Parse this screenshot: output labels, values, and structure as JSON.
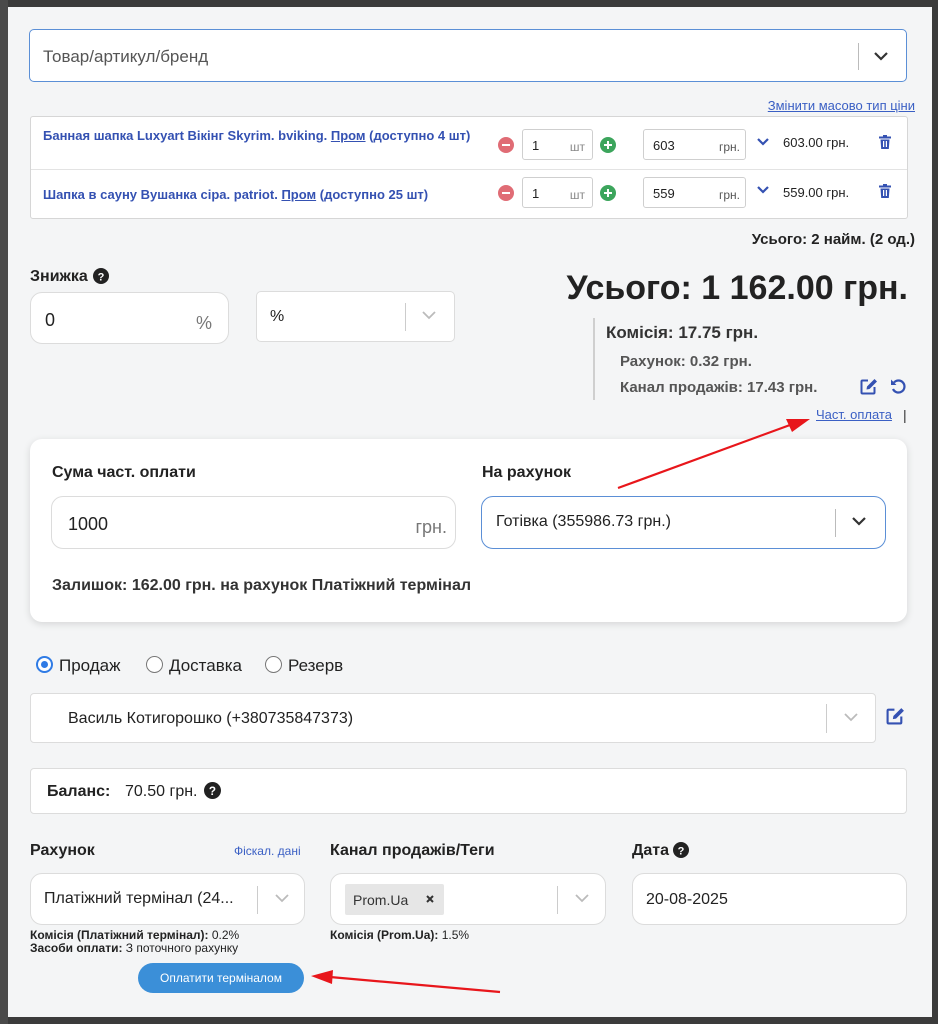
{
  "search": {
    "placeholder": "Товар/артикул/бренд"
  },
  "bulk_price_link": "Змінити масово тип ціни",
  "items": [
    {
      "name": "Банная шапка Luxyart Вікінг Skyrim. bviking.",
      "source": "Пром",
      "stock": "(доступно 4 шт)",
      "qty": "1",
      "qty_unit": "шт",
      "price": "603",
      "price_unit": "грн.",
      "total": "603.00 грн."
    },
    {
      "name": "Шапка в сауну Вушанка сіра. patriot.",
      "source": "Пром",
      "stock": "(доступно 25 шт)",
      "qty": "1",
      "qty_unit": "шт",
      "price": "559",
      "price_unit": "грн.",
      "total": "559.00 грн."
    }
  ],
  "items_summary": "Усього: 2 найм. (2 од.)",
  "discount": {
    "label": "Знижка",
    "value": "0",
    "unit": "%",
    "type": "%"
  },
  "totals": {
    "grand": "Усього: 1 162.00 грн.",
    "commission": "Комісія: 17.75 грн.",
    "commission_account": "Рахунок: 0.32 грн.",
    "commission_channel": "Канал продажів: 17.43 грн.",
    "partial_link": "Част. оплата",
    "separator": "|"
  },
  "partial": {
    "sum_label": "Сума част. оплати",
    "sum_value": "1000",
    "sum_unit": "грн.",
    "account_label": "На рахунок",
    "account_value": "Готівка (355986.73 грн.)",
    "remainder": "Залишок: 162.00 грн. на рахунок Платіжний термінал"
  },
  "order_types": [
    {
      "label": "Продаж",
      "selected": true
    },
    {
      "label": "Доставка",
      "selected": false
    },
    {
      "label": "Резерв",
      "selected": false
    }
  ],
  "customer": {
    "value": "Василь Котигорошко (+380735847373)"
  },
  "balance": {
    "label": "Баланс:",
    "value": "70.50 грн."
  },
  "account": {
    "label": "Рахунок",
    "fiscal_link": "Фіскал. дані",
    "value": "Платіжний термінал (24...",
    "commission_label": "Комісія (Платіжний термінал):",
    "commission_value": "0.2%",
    "payment_label": "Засоби оплати:",
    "payment_value": "З поточного рахунку",
    "pay_button": "Оплатити терміналом"
  },
  "channel": {
    "label": "Канал продажів/Теги",
    "tag": "Prom.Ua",
    "commission_label": "Комісія (Prom.Ua):",
    "commission_value": "1.5%"
  },
  "date": {
    "label": "Дата",
    "value": "20-08-2025"
  },
  "colors": {
    "link": "#3a5fc4",
    "item_name": "#3451b2",
    "primary": "#3b8fd8",
    "focus": "#5b8fd6",
    "annotation": "#e8161b"
  },
  "icons": [
    "chevron-down-icon",
    "minus-circle-icon",
    "plus-circle-icon",
    "trash-icon",
    "question-circle-icon",
    "edit-icon",
    "undo-icon",
    "close-icon"
  ]
}
